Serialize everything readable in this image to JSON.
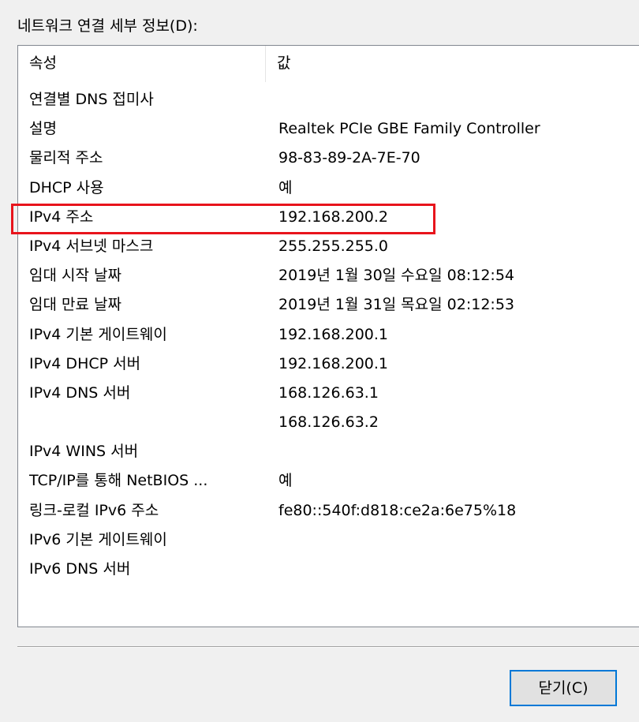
{
  "group_label": "네트워크 연결 세부 정보(D):",
  "list": {
    "columns": [
      "속성",
      "값"
    ],
    "rows": [
      {
        "property": "연결별 DNS 접미사",
        "value": ""
      },
      {
        "property": "설명",
        "value": "Realtek PCIe GBE Family Controller"
      },
      {
        "property": "물리적 주소",
        "value": "98-83-89-2A-7E-70"
      },
      {
        "property": "DHCP 사용",
        "value": "예"
      },
      {
        "property": "IPv4 주소",
        "value": "192.168.200.2",
        "highlighted": true
      },
      {
        "property": "IPv4 서브넷 마스크",
        "value": "255.255.255.0"
      },
      {
        "property": "임대 시작 날짜",
        "value": "2019년 1월 30일 수요일 08:12:54"
      },
      {
        "property": "임대 만료 날짜",
        "value": "2019년 1월 31일 목요일 02:12:53"
      },
      {
        "property": "IPv4 기본 게이트웨이",
        "value": "192.168.200.1"
      },
      {
        "property": "IPv4 DHCP 서버",
        "value": "192.168.200.1"
      },
      {
        "property": "IPv4 DNS 서버",
        "value": "168.126.63.1"
      },
      {
        "property": "",
        "value": "168.126.63.2"
      },
      {
        "property": "IPv4 WINS 서버",
        "value": ""
      },
      {
        "property": "TCP/IP를 통해 NetBIOS ...",
        "value": "예"
      },
      {
        "property": "링크-로컬 IPv6 주소",
        "value": "fe80::540f:d818:ce2a:6e75%18"
      },
      {
        "property": "IPv6 기본 게이트웨이",
        "value": ""
      },
      {
        "property": "IPv6 DNS 서버",
        "value": ""
      }
    ]
  },
  "highlight_color": "#e8141c",
  "close_button_label": "닫기(C)"
}
